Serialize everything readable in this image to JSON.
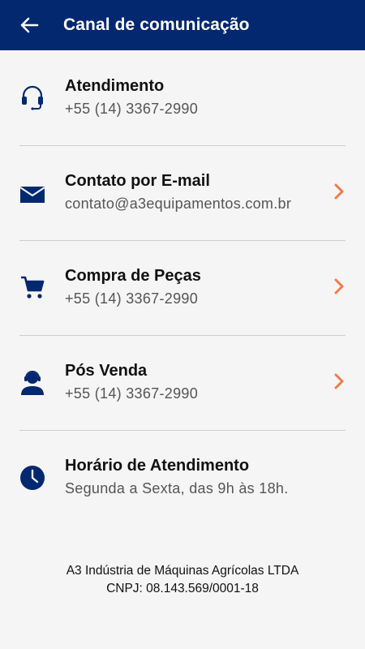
{
  "header": {
    "title": "Canal de comunicação",
    "back_icon": "arrow-left-icon"
  },
  "colors": {
    "primary": "#032870",
    "accent": "#f07a4a",
    "background": "#f5f5f5"
  },
  "items": [
    {
      "icon": "headset-icon",
      "title": "Atendimento",
      "subtitle": "+55 (14) 3367-2990",
      "has_chevron": false
    },
    {
      "icon": "mail-icon",
      "title": "Contato por E-mail",
      "subtitle": "contato@a3equipamentos.com.br",
      "has_chevron": true
    },
    {
      "icon": "cart-icon",
      "title": "Compra de Peças",
      "subtitle": "+55 (14) 3367-2990",
      "has_chevron": true
    },
    {
      "icon": "support-agent-icon",
      "title": "Pós Venda",
      "subtitle": "+55 (14) 3367-2990",
      "has_chevron": true
    },
    {
      "icon": "clock-icon",
      "title": "Horário de Atendimento",
      "subtitle": "Segunda a Sexta, das 9h às 18h.",
      "has_chevron": false
    }
  ],
  "footer": {
    "company": "A3 Indústria de Máquinas Agrícolas LTDA",
    "cnpj": "CNPJ: 08.143.569/0001-18"
  }
}
